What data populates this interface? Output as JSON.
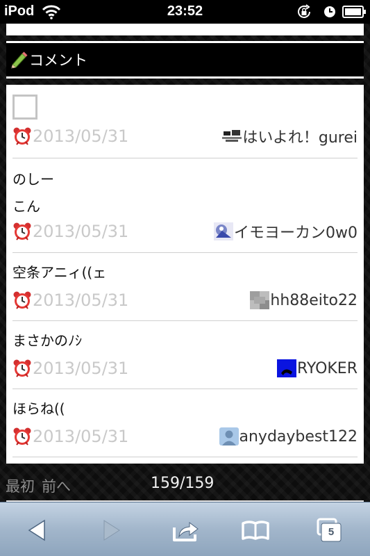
{
  "status_bar": {
    "carrier": "iPod",
    "time": "23:52",
    "icons": [
      "wifi-icon",
      "rotation-lock-icon",
      "alarm-clock-icon",
      "battery-icon"
    ]
  },
  "header": {
    "icon": "pencil-icon",
    "title": "コメント"
  },
  "comments": [
    {
      "text_lines": [],
      "has_checkbox": true,
      "date": "2013/05/31",
      "user": "はいよれ！gurei",
      "avatar": "avatar-gurei"
    },
    {
      "text_lines": [
        "のしー",
        "こん"
      ],
      "has_checkbox": false,
      "date": "2013/05/31",
      "user": "イモヨーカン0w0",
      "avatar": "avatar-imoyokan"
    },
    {
      "text_lines": [
        "空条アニィ((ェ"
      ],
      "has_checkbox": false,
      "date": "2013/05/31",
      "user": "hh88eito22",
      "avatar": "avatar-hh88eito22"
    },
    {
      "text_lines": [
        "まさかのﾉｼ"
      ],
      "has_checkbox": false,
      "date": "2013/05/31",
      "user": "RYOKER",
      "avatar": "avatar-ryoker"
    },
    {
      "text_lines": [
        "ほらね(("
      ],
      "has_checkbox": false,
      "date": "2013/05/31",
      "user": "anydaybest122",
      "avatar": "avatar-anydaybest122"
    }
  ],
  "pager": {
    "first": "最初",
    "prev": "前へ",
    "count": "159/159"
  },
  "toolbar": {
    "buttons": [
      "back-icon",
      "forward-icon",
      "share-icon",
      "bookmarks-icon",
      "tabs-icon"
    ],
    "tab_count": "5"
  },
  "colors": {
    "page_background": "#0d0d0d",
    "date_text": "#c9c9c9",
    "toolbar_top": "#c4d3e3",
    "toolbar_bottom": "#8ea5bd"
  }
}
